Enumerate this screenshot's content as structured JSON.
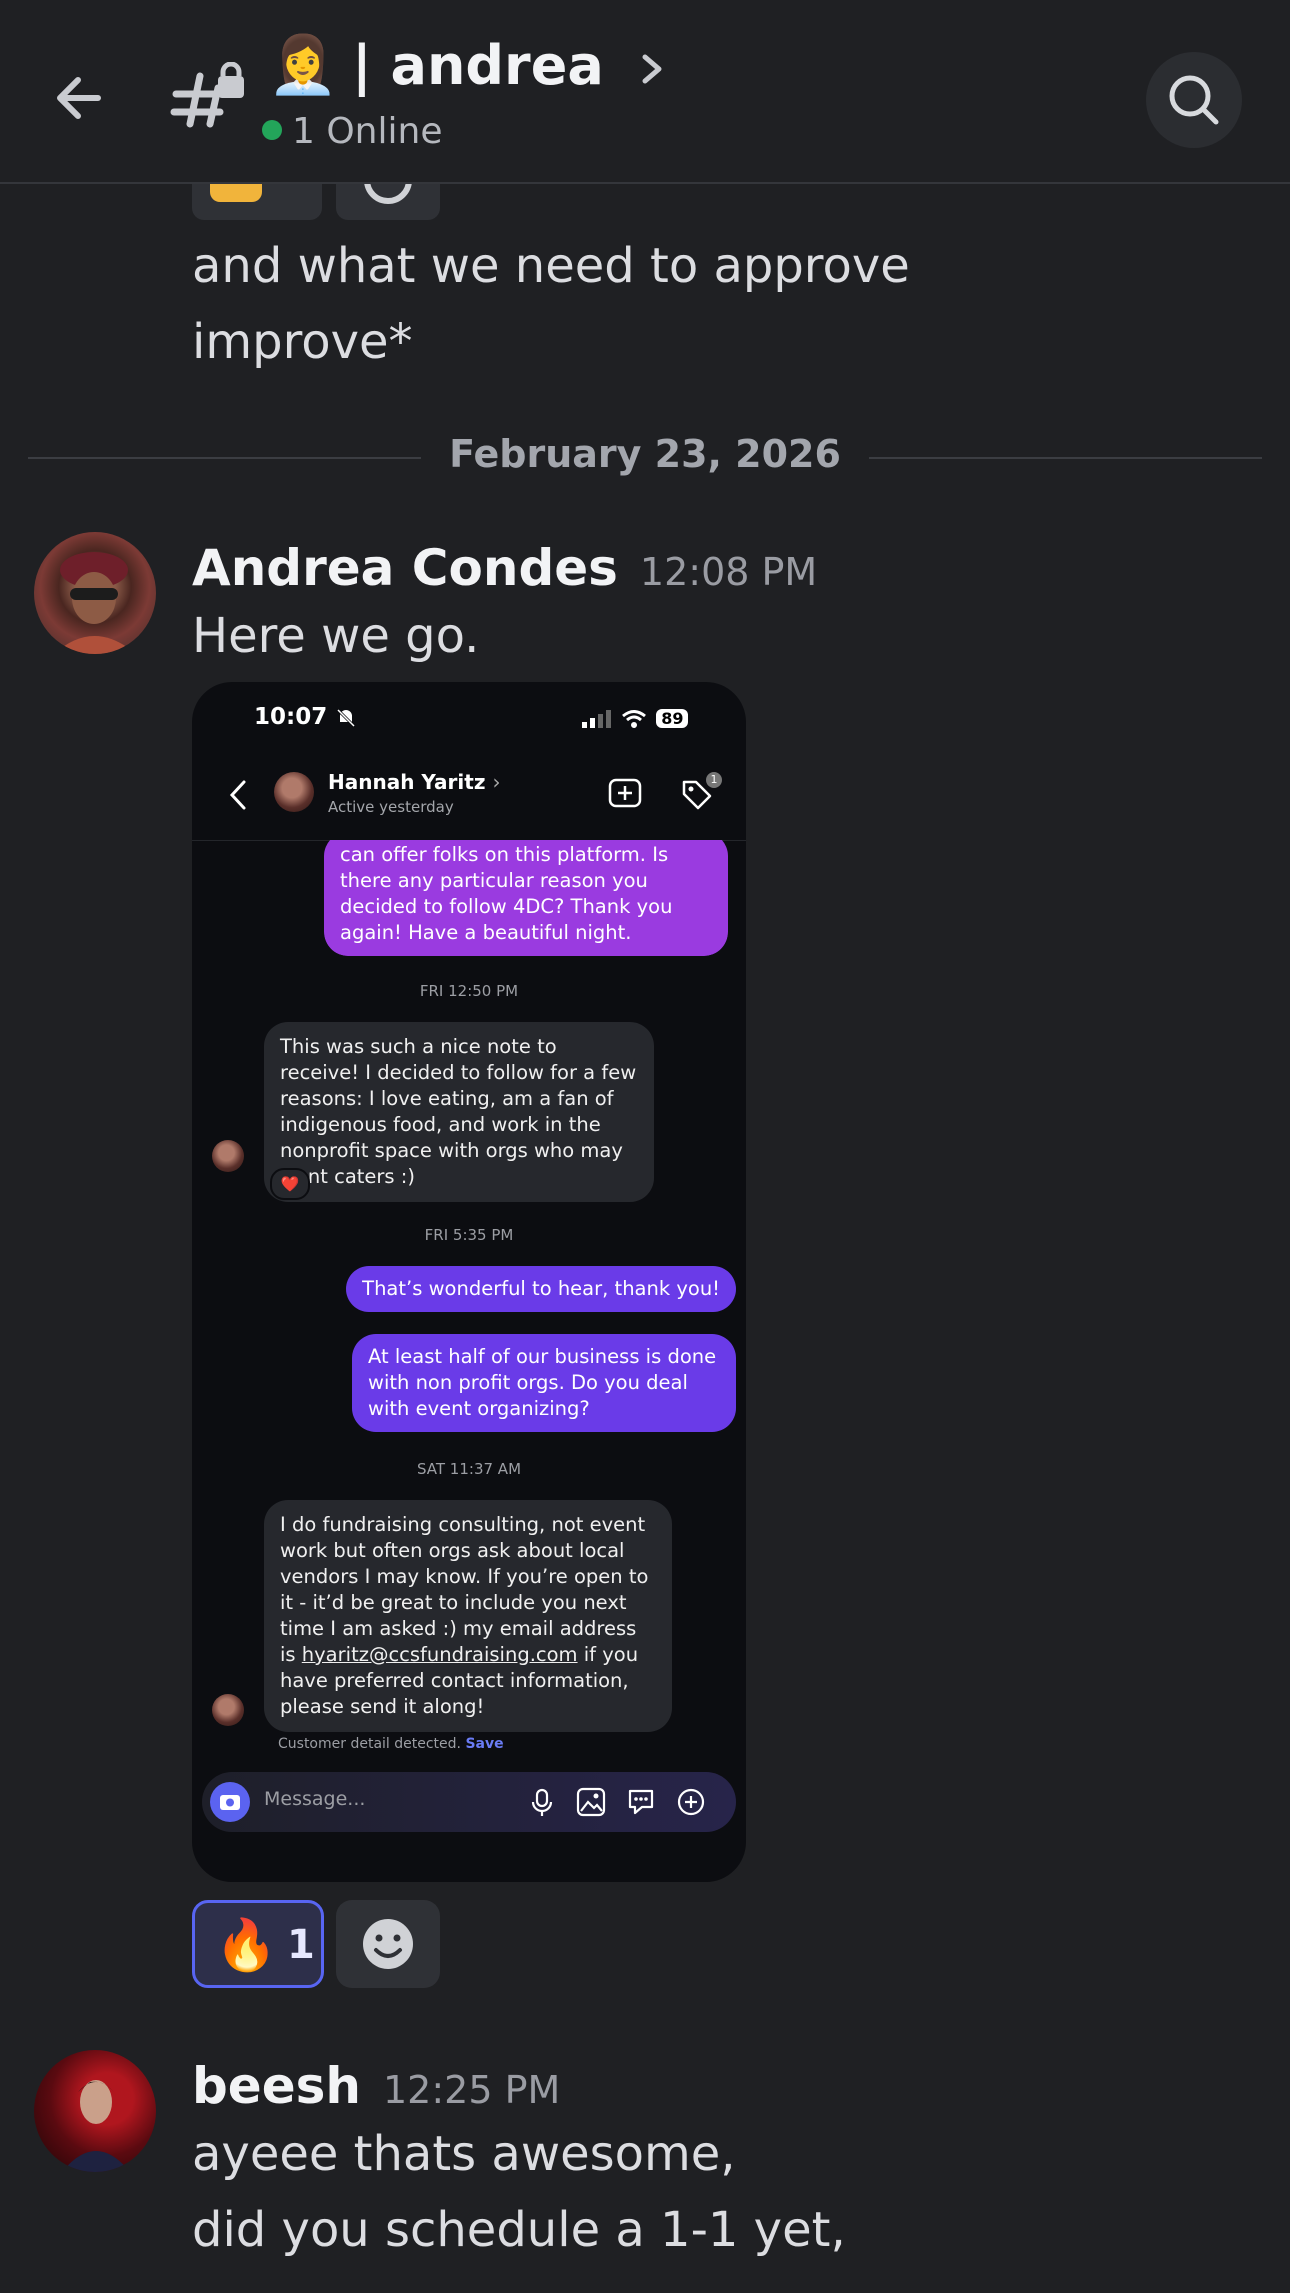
{
  "header": {
    "back_label": "Back",
    "channel_emoji": "👩‍💼",
    "title": "| andrea",
    "online_text": "1 Online"
  },
  "previous_message": {
    "line1": "and what we need to approve",
    "line2": "improve*"
  },
  "date_divider": "February 23, 2026",
  "messages": [
    {
      "author": "Andrea Condes",
      "time": "12:08 PM",
      "text": "Here we go.",
      "attachment": {
        "status_time": "10:07",
        "battery": "89",
        "contact_name": "Hannah Yaritz",
        "contact_status": "Active yesterday",
        "tag_badge": "1",
        "bubble1": "can offer folks on this platform. Is there any particular reason you decided to follow 4DC? Thank you again! Have a beautiful night.",
        "time1": "FRI 12:50 PM",
        "bubble2": "This was such a nice note to receive! I decided to follow for a few reasons: I love eating, am a fan of indigenous food, and work in the nonprofit space with orgs who may want caters :)",
        "bubble2_reaction": "❤️",
        "time2": "FRI 5:35 PM",
        "bubble3": "That’s wonderful to hear, thank you!",
        "bubble4": "At least half of our business is done with non profit orgs. Do you deal with event organizing?",
        "time3": "SAT 11:37 AM",
        "bubble5_part1": "I do fundraising consulting, not event work but often orgs ask about local vendors I may know. If you’re open to it - it’d be great to include you next time I am asked :) my email address is ",
        "bubble5_email": "hyaritz@ccsfundraising.com",
        "bubble5_part2": " if you have preferred contact information, please send it along!",
        "detected_text": "Customer detail detected.",
        "detected_action": "Save",
        "composer_placeholder": "Message..."
      },
      "reactions": [
        {
          "emoji": "🔥",
          "count": "1"
        }
      ]
    },
    {
      "author": "beesh",
      "time": "12:25 PM",
      "line1": "ayeee thats awesome,",
      "line2": "did you schedule a 1-1 yet,"
    }
  ],
  "colors": {
    "background": "#1f2023",
    "online": "#23a55a",
    "reaction_active": "#5865f2",
    "bubble_purple": "#9a3be0",
    "bubble_violet": "#6a3be8"
  }
}
